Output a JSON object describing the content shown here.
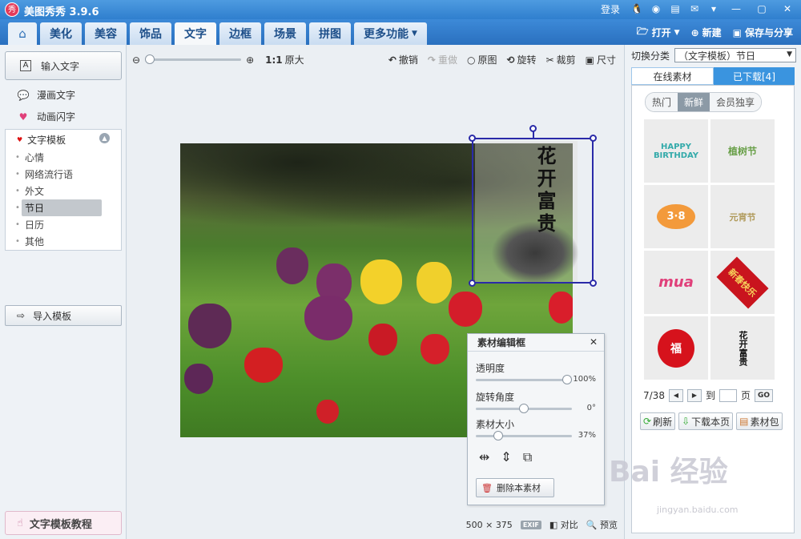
{
  "titlebar": {
    "app_name": "美图秀秀 3.9.6",
    "logo_text": "秀",
    "login": "登录"
  },
  "nav": {
    "tabs": [
      "美化",
      "美容",
      "饰品",
      "文字",
      "边框",
      "场景",
      "拼图"
    ],
    "active_tab": "文字",
    "more": "更多功能",
    "open": "打开",
    "new": "新建",
    "save_share": "保存与分享"
  },
  "left": {
    "input_text": "输入文字",
    "comic_text": "漫画文字",
    "animated_text": "动画闪字",
    "template_header": "文字模板",
    "template_items": [
      "心情",
      "网络流行语",
      "外文",
      "节日",
      "日历",
      "其他"
    ],
    "selected_item": "节日",
    "import_template": "导入模板",
    "tutorial": "文字模板教程"
  },
  "toolbar": {
    "zoom_original_ratio": "1:1",
    "zoom_original_label": "原大",
    "undo": "撤销",
    "redo": "重做",
    "original": "原图",
    "rotate": "旋转",
    "crop": "裁剪",
    "size": "尺寸"
  },
  "sticker": {
    "calligraphy": "花开富贵"
  },
  "edit_box": {
    "title": "素材编辑框",
    "opacity_label": "透明度",
    "opacity_value": "100%",
    "opacity_level": 1.0,
    "rotation_label": "旋转角度",
    "rotation_value": "0°",
    "rotation_level": 0.5,
    "size_label": "素材大小",
    "size_value": "37%",
    "size_level": 0.2,
    "delete_label": "删除本素材"
  },
  "status": {
    "width": "500",
    "times": "×",
    "height": "375",
    "exif": "EXIF",
    "compare": "对比",
    "preview": "预览"
  },
  "right": {
    "switch_label": "切换分类",
    "switch_value": "（文字模板）节日",
    "tab_online": "在线素材",
    "tab_downloaded": "已下载[4]",
    "seg_hot": "热门",
    "seg_new": "新鲜",
    "seg_member": "会员独享",
    "thumbs": [
      "HAPPY BIRTHDAY",
      "植树节",
      "3·8",
      "元宵节",
      "mua",
      "新春快乐",
      "福",
      "花开富贵"
    ],
    "page_current": "7/38",
    "page_to": "到",
    "page_unit": "页",
    "go": "GO",
    "refresh": "刷新",
    "download_page": "下载本页",
    "material_pack": "素材包"
  },
  "watermark": {
    "brand": "Bai 经验",
    "url": "jingyan.baidu.com"
  },
  "colors": {
    "accent": "#2f7fce",
    "selection": "#2a2aa8"
  }
}
